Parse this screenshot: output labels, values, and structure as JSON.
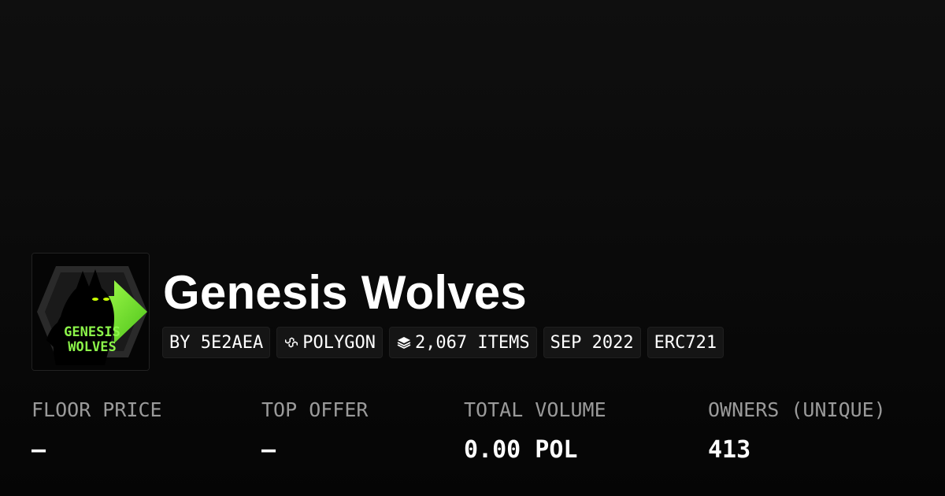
{
  "collection": {
    "name": "Genesis Wolves",
    "logo_text_line1": "GENESIS",
    "logo_text_line2": "WOLVES"
  },
  "badges": [
    {
      "label": "BY 5E2AEA",
      "icon": null
    },
    {
      "label": "POLYGON",
      "icon": "polygon-chain-icon"
    },
    {
      "label": "2,067 ITEMS",
      "icon": "layers-icon"
    },
    {
      "label": "SEP 2022",
      "icon": null
    },
    {
      "label": "ERC721",
      "icon": null
    }
  ],
  "stats": [
    {
      "label": "FLOOR PRICE",
      "value": "–"
    },
    {
      "label": "TOP OFFER",
      "value": "–"
    },
    {
      "label": "TOTAL VOLUME",
      "value": "0.00 POL"
    },
    {
      "label": "OWNERS (UNIQUE)",
      "value": "413"
    }
  ],
  "colors": {
    "background": "#0b0b0b",
    "text": "#ffffff",
    "muted": "#9a9a9a",
    "badge_bg": "#151515",
    "logo_accent": "#7cf33a"
  }
}
